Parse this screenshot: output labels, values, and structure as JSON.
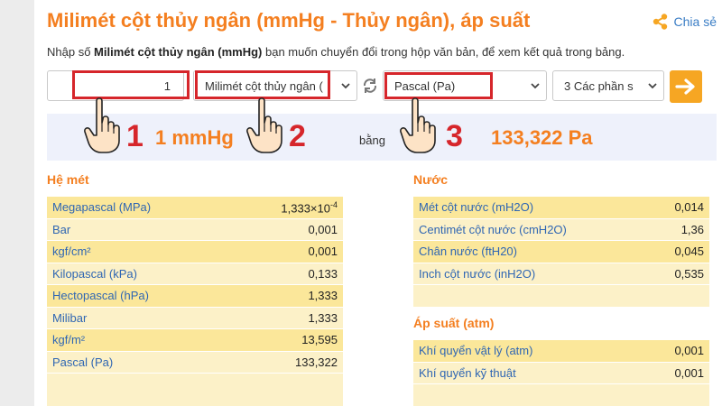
{
  "header": {
    "title": "Milimét cột thủy ngân (mmHg - Thủy ngân), áp suất",
    "share_label": "Chia sẻ"
  },
  "description": {
    "prefix": "Nhập số ",
    "bold": "Milimét cột thủy ngân (mmHg)",
    "suffix": " bạn muốn chuyển đổi trong hộp văn bản, để xem kết quả trong bảng."
  },
  "converter": {
    "input_value": "1",
    "from_unit": "Milimét cột thủy ngân (",
    "to_unit": "Pascal (Pa)",
    "precision": "3 Các phần s"
  },
  "result": {
    "from_value": "1 mmHg",
    "equals_label": "bằng",
    "to_value": "133,322 Pa"
  },
  "steps": [
    "1",
    "2",
    "3"
  ],
  "metric": {
    "title": "Hệ mét",
    "rows": [
      {
        "label": "Megapascal (MPa)",
        "value": "1,333×10",
        "exp": "-4"
      },
      {
        "label": "Bar",
        "value": "0,001"
      },
      {
        "label": "kgf/cm²",
        "value": "0,001"
      },
      {
        "label": "Kilopascal (kPa)",
        "value": "0,133"
      },
      {
        "label": "Hectopascal (hPa)",
        "value": "1,333"
      },
      {
        "label": "Milibar",
        "value": "1,333"
      },
      {
        "label": "kgf/m²",
        "value": "13,595"
      },
      {
        "label": "Pascal (Pa)",
        "value": "133,322"
      }
    ]
  },
  "water": {
    "title": "Nước",
    "rows": [
      {
        "label": "Mét cột nước (mH2O)",
        "value": "0,014"
      },
      {
        "label": "Centimét cột nước (cmH2O)",
        "value": "1,36"
      },
      {
        "label": "Chân nước (ftH20)",
        "value": "0,045"
      },
      {
        "label": "Inch cột nước (inH2O)",
        "value": "0,535"
      }
    ]
  },
  "atm": {
    "title": "Áp suất (atm)",
    "rows": [
      {
        "label": "Khí quyển vật lý (atm)",
        "value": "0,001"
      },
      {
        "label": "Khí quyển kỹ thuật",
        "value": "0,001"
      }
    ]
  },
  "colors": {
    "accent": "#f47f20",
    "highlight": "#d6262b",
    "link": "#2f66b3",
    "table_row": "#fbe79a",
    "table_alt": "#fcf1c8",
    "result_bg": "#eef1fb",
    "go_button": "#f6a623"
  },
  "icons": [
    "share-icon",
    "chevron-down-icon",
    "swap-icon",
    "arrow-right-icon",
    "pointing-hand-icon"
  ]
}
